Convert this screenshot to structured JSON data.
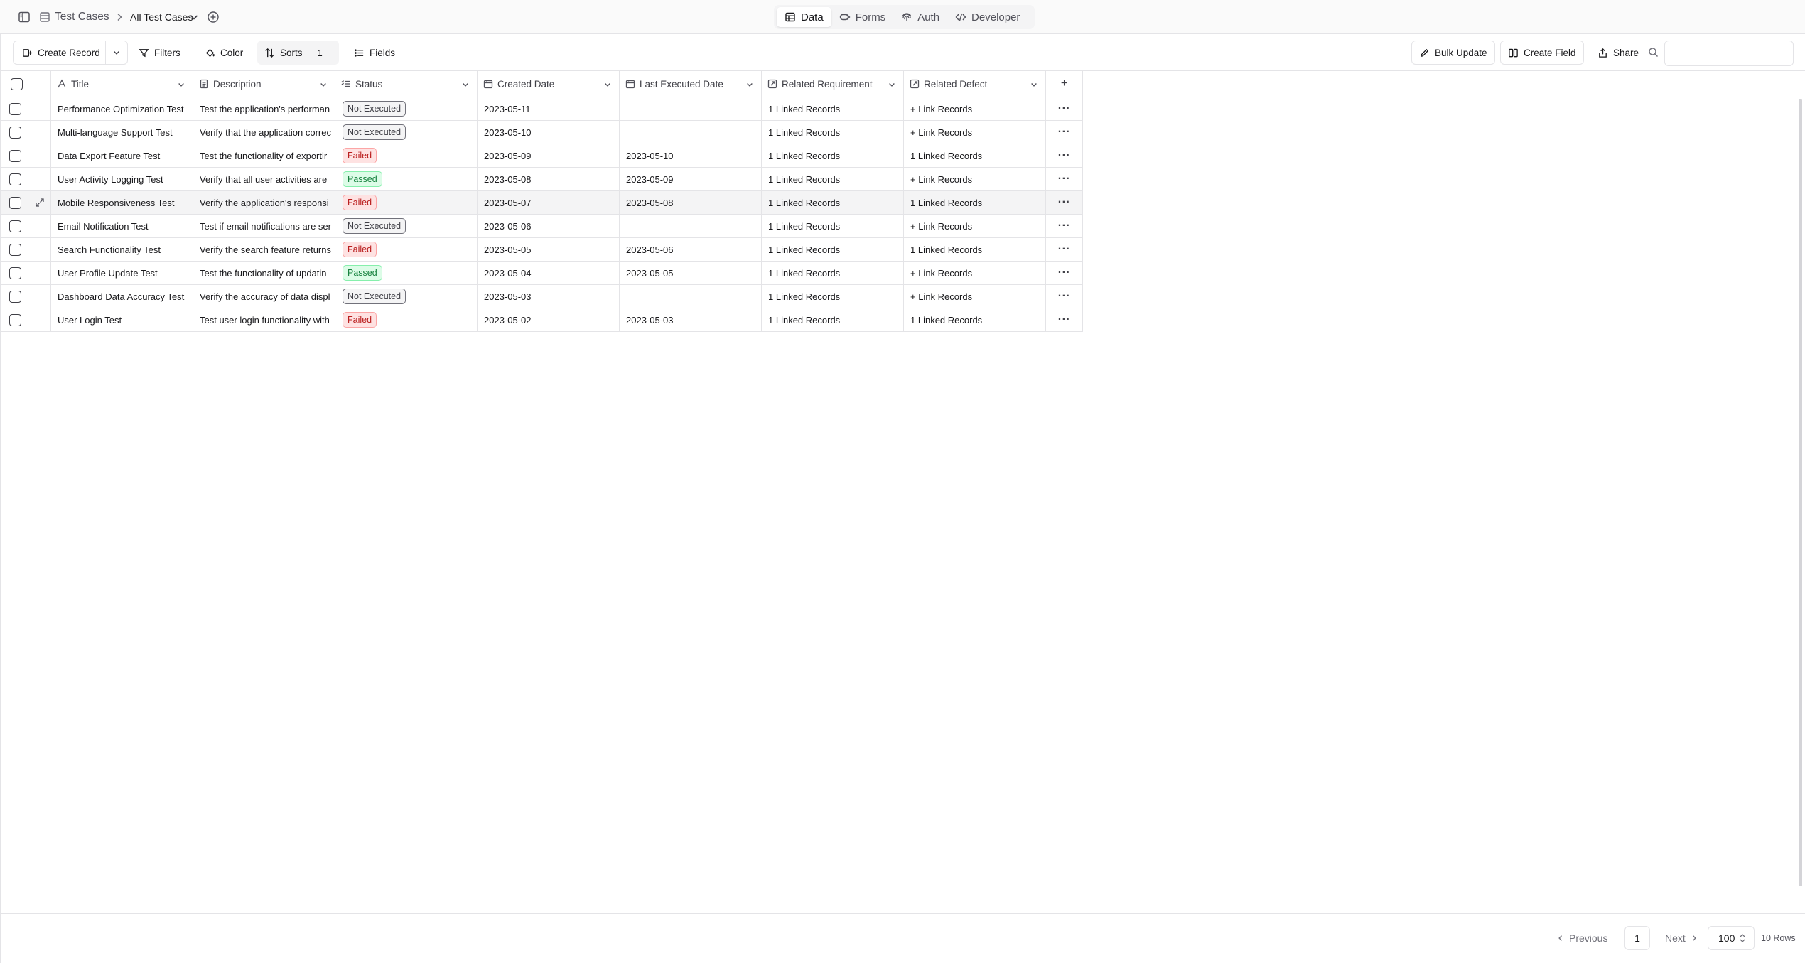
{
  "header": {
    "breadcrumb_base": "Test Cases",
    "view_name": "All Test Cases",
    "tabs": [
      {
        "label": "Data",
        "icon": "table-icon",
        "active": true
      },
      {
        "label": "Forms",
        "icon": "form-icon",
        "active": false
      },
      {
        "label": "Auth",
        "icon": "fingerprint-icon",
        "active": false
      },
      {
        "label": "Developer",
        "icon": "code-icon",
        "active": false
      }
    ]
  },
  "toolbar": {
    "create_record": "Create Record",
    "filters": "Filters",
    "color": "Color",
    "sorts": "Sorts",
    "sorts_count": "1",
    "fields": "Fields",
    "bulk_update": "Bulk Update",
    "create_field": "Create Field",
    "share": "Share",
    "search_value": "",
    "search_placeholder": ""
  },
  "table": {
    "columns": [
      {
        "label": "Title",
        "icon": "text-icon"
      },
      {
        "label": "Description",
        "icon": "document-icon"
      },
      {
        "label": "Status",
        "icon": "list-icon"
      },
      {
        "label": "Created Date",
        "icon": "calendar-icon"
      },
      {
        "label": "Last Executed Date",
        "icon": "calendar-icon"
      },
      {
        "label": "Related Requirement",
        "icon": "link-icon"
      },
      {
        "label": "Related Defect",
        "icon": "link-icon"
      }
    ],
    "add_column": "+",
    "rows": [
      {
        "title": "Performance Optimization Test",
        "description": "Test the application's performan",
        "status": "Not Executed",
        "created": "2023-05-11",
        "executed": "",
        "requirement": "1 Linked Records",
        "defect": "+ Link Records"
      },
      {
        "title": "Multi-language Support Test",
        "description": "Verify that the application correc",
        "status": "Not Executed",
        "created": "2023-05-10",
        "executed": "",
        "requirement": "1 Linked Records",
        "defect": "+ Link Records"
      },
      {
        "title": "Data Export Feature Test",
        "description": "Test the functionality of exportir",
        "status": "Failed",
        "created": "2023-05-09",
        "executed": "2023-05-10",
        "requirement": "1 Linked Records",
        "defect": "1 Linked Records"
      },
      {
        "title": "User Activity Logging Test",
        "description": "Verify that all user activities are",
        "status": "Passed",
        "created": "2023-05-08",
        "executed": "2023-05-09",
        "requirement": "1 Linked Records",
        "defect": "+ Link Records"
      },
      {
        "title": "Mobile Responsiveness Test",
        "description": "Verify the application's responsi",
        "status": "Failed",
        "created": "2023-05-07",
        "executed": "2023-05-08",
        "requirement": "1 Linked Records",
        "defect": "1 Linked Records"
      },
      {
        "title": "Email Notification Test",
        "description": "Test if email notifications are ser",
        "status": "Not Executed",
        "created": "2023-05-06",
        "executed": "",
        "requirement": "1 Linked Records",
        "defect": "+ Link Records"
      },
      {
        "title": "Search Functionality Test",
        "description": "Verify the search feature returns",
        "status": "Failed",
        "created": "2023-05-05",
        "executed": "2023-05-06",
        "requirement": "1 Linked Records",
        "defect": "1 Linked Records"
      },
      {
        "title": "User Profile Update Test",
        "description": "Test the functionality of updatin",
        "status": "Passed",
        "created": "2023-05-04",
        "executed": "2023-05-05",
        "requirement": "1 Linked Records",
        "defect": "+ Link Records"
      },
      {
        "title": "Dashboard Data Accuracy Test",
        "description": "Verify the accuracy of data displ",
        "status": "Not Executed",
        "created": "2023-05-03",
        "executed": "",
        "requirement": "1 Linked Records",
        "defect": "+ Link Records"
      },
      {
        "title": "User Login Test",
        "description": "Test user login functionality with",
        "status": "Failed",
        "created": "2023-05-02",
        "executed": "2023-05-03",
        "requirement": "1 Linked Records",
        "defect": "1 Linked Records"
      }
    ],
    "highlighted_row": 4,
    "row_menu_glyph": "···"
  },
  "pagination": {
    "previous": "Previous",
    "next": "Next",
    "current_page": "1",
    "page_size": "100",
    "rows_count": "10 Rows"
  },
  "colors": {
    "failed_bg": "#fee2e2",
    "failed_text": "#b91c1c",
    "passed_bg": "#dcfce7",
    "passed_text": "#15803d",
    "not_executed_bg": "#f4f4f5"
  }
}
